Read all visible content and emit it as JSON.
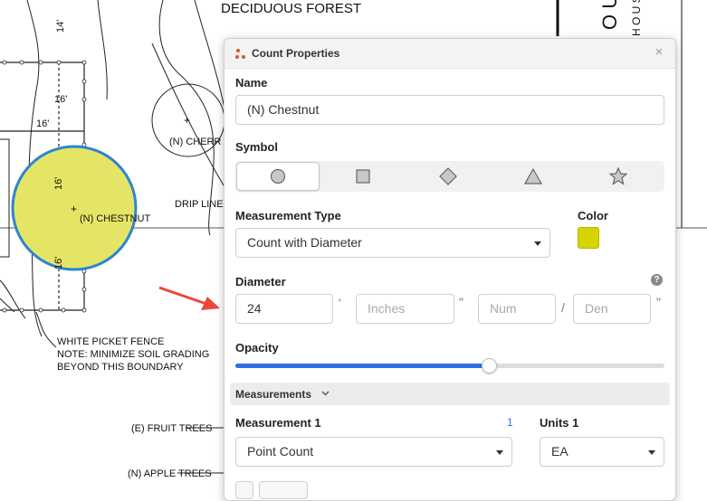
{
  "drawing": {
    "labels": {
      "deciduous_forest": "DECIDUOUS FOREST",
      "dim_14": "14'",
      "dim_16_top": "16'",
      "dim_16_left": "16'",
      "dim_16_vert": "16'",
      "dim_16_low": "16'",
      "n_cherry": "(N) CHERR",
      "drip_line": "DRIP LINE",
      "n_chestnut": "(N) CHESTNUT",
      "fence_1": "WHITE PICKET FENCE",
      "fence_2": "NOTE: MINIMIZE SOIL GRADING",
      "fence_3": "BEYOND THIS BOUNDARY",
      "fruit_trees": "(E) FRUIT TREES",
      "apple_trees": "(N) APPLE TREES",
      "side_big": "O U",
      "side_small": "H O U S"
    },
    "colors": {
      "chestnut_fill": "#e4e566",
      "chestnut_stroke": "#2b86cf",
      "arrow": "#f0453a"
    }
  },
  "panel": {
    "title": "Count Properties",
    "close_icon": "×",
    "name": {
      "label": "Name",
      "value": "(N) Chestnut"
    },
    "symbol": {
      "label": "Symbol",
      "options": [
        "circle",
        "square",
        "diamond",
        "triangle",
        "star"
      ],
      "selected": "circle"
    },
    "measurement_type": {
      "label": "Measurement Type",
      "value": "Count with Diameter"
    },
    "color": {
      "label": "Color",
      "value": "#d6d400"
    },
    "diameter": {
      "label": "Diameter",
      "help": "?",
      "feet": "24",
      "feet_mark": "'",
      "inches_placeholder": "Inches",
      "inches_mark": "\"",
      "num_placeholder": "Num",
      "slash": "/",
      "den_placeholder": "Den",
      "den_mark": "\""
    },
    "opacity": {
      "label": "Opacity",
      "value": 0.59,
      "accent": "#2f6fe4"
    },
    "measurements": {
      "label": "Measurements",
      "measurement_1_label": "Measurement 1",
      "count": "1",
      "measurement_1_value": "Point Count",
      "units_label": "Units 1",
      "units_value": "EA"
    }
  }
}
